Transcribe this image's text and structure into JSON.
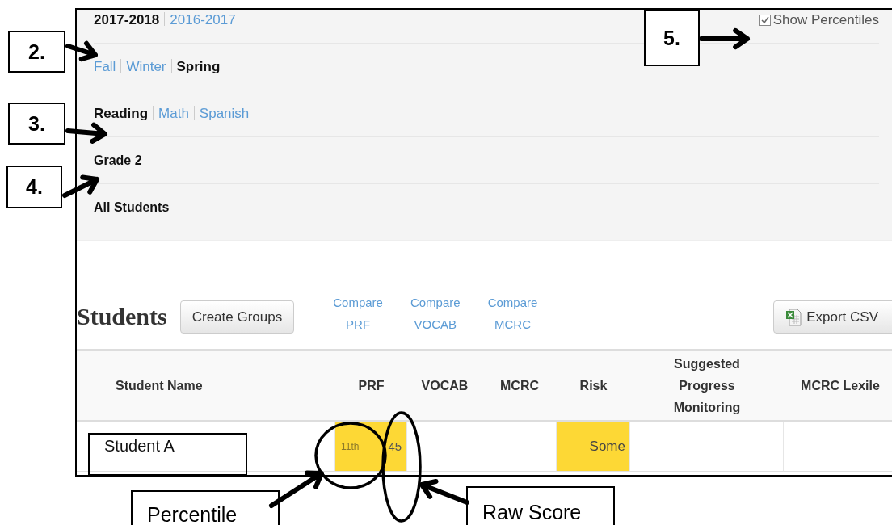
{
  "filters": {
    "years": [
      {
        "label": "2017-2018",
        "selected": true
      },
      {
        "label": "2016-2017",
        "selected": false
      }
    ],
    "terms": [
      {
        "label": "Fall",
        "selected": false
      },
      {
        "label": "Winter",
        "selected": false
      },
      {
        "label": "Spring",
        "selected": true
      }
    ],
    "subjects": [
      {
        "label": "Reading",
        "selected": true
      },
      {
        "label": "Math",
        "selected": false
      },
      {
        "label": "Spanish",
        "selected": false
      }
    ],
    "grade": "Grade 2",
    "group": "All Students",
    "show_percentiles": {
      "label": "Show Percentiles",
      "checked": true
    }
  },
  "students": {
    "title": "Students",
    "create_button": "Create Groups",
    "compare_links": [
      {
        "line1": "Compare",
        "line2": "PRF"
      },
      {
        "line1": "Compare",
        "line2": "VOCAB"
      },
      {
        "line1": "Compare",
        "line2": "MCRC"
      }
    ],
    "export_button": "Export CSV"
  },
  "table": {
    "columns": [
      "Student Name",
      "PRF",
      "VOCAB",
      "MCRC",
      "Risk",
      "Suggested Progress Monitoring",
      "MCRC Lexile"
    ],
    "rows": [
      {
        "cells": [
          {
            "kind": "name",
            "text": "Student A",
            "highlighted": false
          },
          {
            "kind": "score",
            "percentile": "11th",
            "score": "45",
            "highlighted": true
          },
          {
            "kind": "empty",
            "highlighted": false
          },
          {
            "kind": "empty",
            "highlighted": false
          },
          {
            "kind": "text",
            "text": "Some",
            "highlighted": true
          },
          {
            "kind": "empty",
            "highlighted": false
          },
          {
            "kind": "empty",
            "highlighted": false
          }
        ]
      }
    ]
  },
  "annotations": [
    {
      "kind": "number",
      "text": "2."
    },
    {
      "kind": "number",
      "text": "3."
    },
    {
      "kind": "number",
      "text": "4."
    },
    {
      "kind": "number",
      "text": "5."
    },
    {
      "kind": "label",
      "text": "Percentile"
    },
    {
      "kind": "label",
      "text": "Raw Score"
    }
  ]
}
